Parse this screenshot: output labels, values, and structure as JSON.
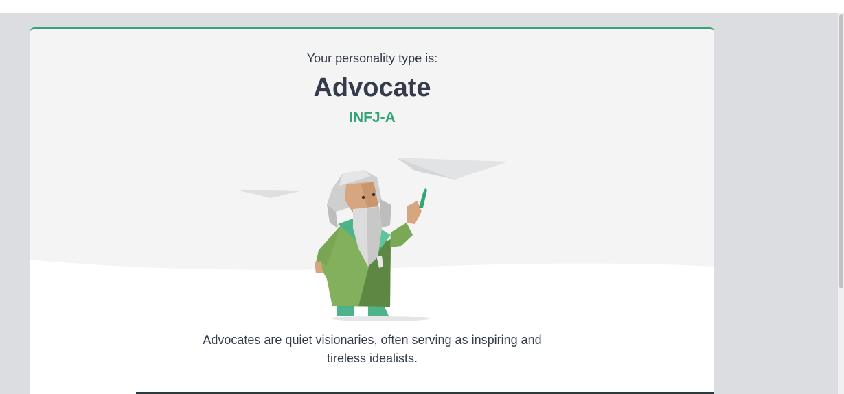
{
  "result": {
    "intro": "Your personality type is:",
    "type_name": "Advocate",
    "type_code": "INFJ-A",
    "description": "Advocates are quiet visionaries, often serving as inspiring and tireless idealists.",
    "illustration_icon": "advocate-character-illustration"
  },
  "colors": {
    "accent": "#33a474",
    "text": "#343c4b",
    "card_bg": "#f4f4f4",
    "page_bg": "#dcdde1"
  }
}
